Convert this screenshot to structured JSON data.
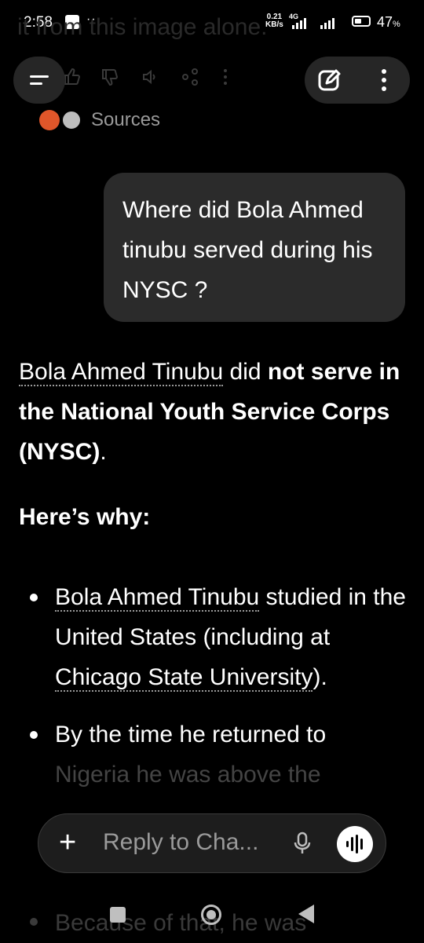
{
  "status_bar": {
    "time": "2:58",
    "more": "···",
    "speed_value": "0.21",
    "speed_unit": "KB/s",
    "network": "4G",
    "battery": "47",
    "battery_unit": "%"
  },
  "background_text": "it from this image alone.",
  "sources_label": "Sources",
  "user_message": "Where did Bola Ahmed tinubu served during his NYSC ?",
  "answer": {
    "intro_link": "Bola Ahmed Tinubu",
    "intro_mid": " did ",
    "intro_bold": "not serve in the National Youth Service Corps (NYSC)",
    "intro_end": ".",
    "heading": "Here’s why:",
    "bullet1_link": "Bola Ahmed Tinubu",
    "bullet1_text": " studied in the United States (including at ",
    "bullet1_link2": "Chicago State University",
    "bullet1_end": ").",
    "bullet2_text": "By the time he returned to",
    "bullet2_faded": "Nigeria he was above the",
    "bullet3_text": "Because of that, he was"
  },
  "reply": {
    "placeholder": "Reply to Cha..."
  },
  "icons": {
    "menu": "menu-icon",
    "edit": "edit-icon",
    "more": "more-vertical-icon",
    "mic": "microphone-icon",
    "voice": "voice-mode-icon",
    "plus": "plus-icon"
  }
}
